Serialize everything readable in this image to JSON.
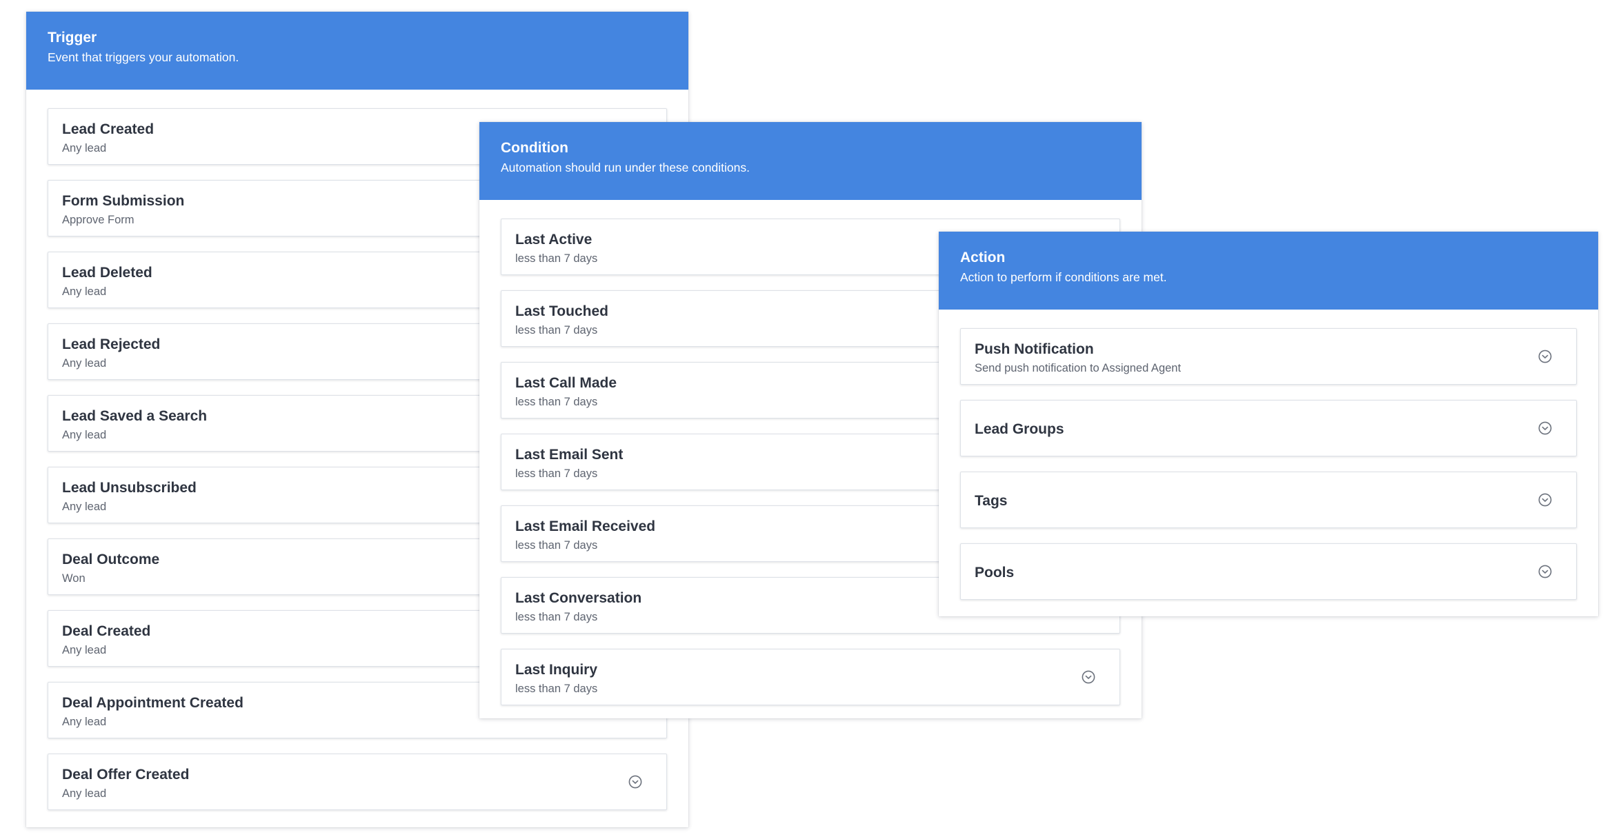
{
  "trigger": {
    "title": "Trigger",
    "subtitle": "Event that triggers your automation.",
    "items": [
      {
        "title": "Lead Created",
        "subtitle": "Any lead"
      },
      {
        "title": "Form Submission",
        "subtitle": "Approve Form"
      },
      {
        "title": "Lead Deleted",
        "subtitle": "Any lead"
      },
      {
        "title": "Lead Rejected",
        "subtitle": "Any lead"
      },
      {
        "title": "Lead Saved a Search",
        "subtitle": "Any lead"
      },
      {
        "title": "Lead Unsubscribed",
        "subtitle": "Any lead"
      },
      {
        "title": "Deal Outcome",
        "subtitle": "Won"
      },
      {
        "title": "Deal Created",
        "subtitle": "Any lead"
      },
      {
        "title": "Deal Appointment Created",
        "subtitle": "Any lead"
      },
      {
        "title": "Deal Offer Created",
        "subtitle": "Any lead"
      }
    ]
  },
  "condition": {
    "title": "Condition",
    "subtitle": "Automation should run under these conditions.",
    "items": [
      {
        "title": "Last Active",
        "subtitle": "less than 7 days"
      },
      {
        "title": "Last Touched",
        "subtitle": "less than 7 days"
      },
      {
        "title": "Last Call Made",
        "subtitle": "less than 7 days"
      },
      {
        "title": "Last Email Sent",
        "subtitle": "less than 7 days"
      },
      {
        "title": "Last Email Received",
        "subtitle": "less than 7 days"
      },
      {
        "title": "Last Conversation",
        "subtitle": "less than 7 days"
      },
      {
        "title": "Last Inquiry",
        "subtitle": "less than 7 days"
      }
    ]
  },
  "action": {
    "title": "Action",
    "subtitle": "Action to perform if conditions are met.",
    "items": [
      {
        "title": "Push Notification",
        "subtitle": "Send push notification to Assigned Agent"
      },
      {
        "title": "Lead Groups"
      },
      {
        "title": "Tags"
      },
      {
        "title": "Pools"
      }
    ]
  },
  "icons": {
    "expand": "chevron-down-circle-icon"
  },
  "colors": {
    "header": "#4485e0",
    "text": "#2f3541",
    "subtext": "#5e6470",
    "icon": "#6b717c"
  }
}
